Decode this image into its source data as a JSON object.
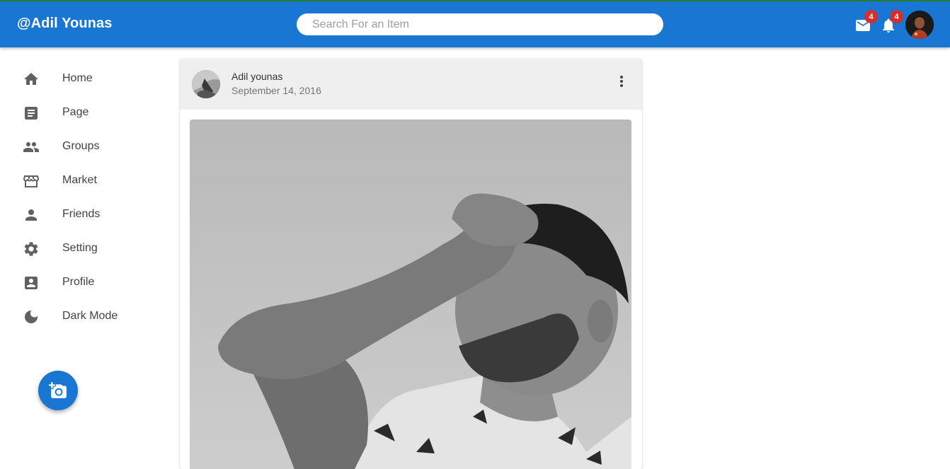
{
  "appbar": {
    "title": "@Adil Younas",
    "search_placeholder": "Search For an Item",
    "mail_count": "4",
    "notification_count": "4"
  },
  "sidebar": {
    "items": [
      {
        "label": "Home",
        "icon": "home-icon"
      },
      {
        "label": "Page",
        "icon": "page-icon"
      },
      {
        "label": "Groups",
        "icon": "groups-icon"
      },
      {
        "label": "Market",
        "icon": "market-icon"
      },
      {
        "label": "Friends",
        "icon": "friends-icon"
      },
      {
        "label": "Setting",
        "icon": "gear-icon"
      },
      {
        "label": "Profile",
        "icon": "profile-icon"
      },
      {
        "label": "Dark Mode",
        "icon": "moon-icon"
      }
    ]
  },
  "fab": {
    "icon": "add-photo-icon"
  },
  "post": {
    "author": "Adil younas",
    "date": "September 14, 2016"
  },
  "colors": {
    "primary": "#1976d2",
    "badge": "#d32f2f",
    "header_bg": "#efefef"
  }
}
